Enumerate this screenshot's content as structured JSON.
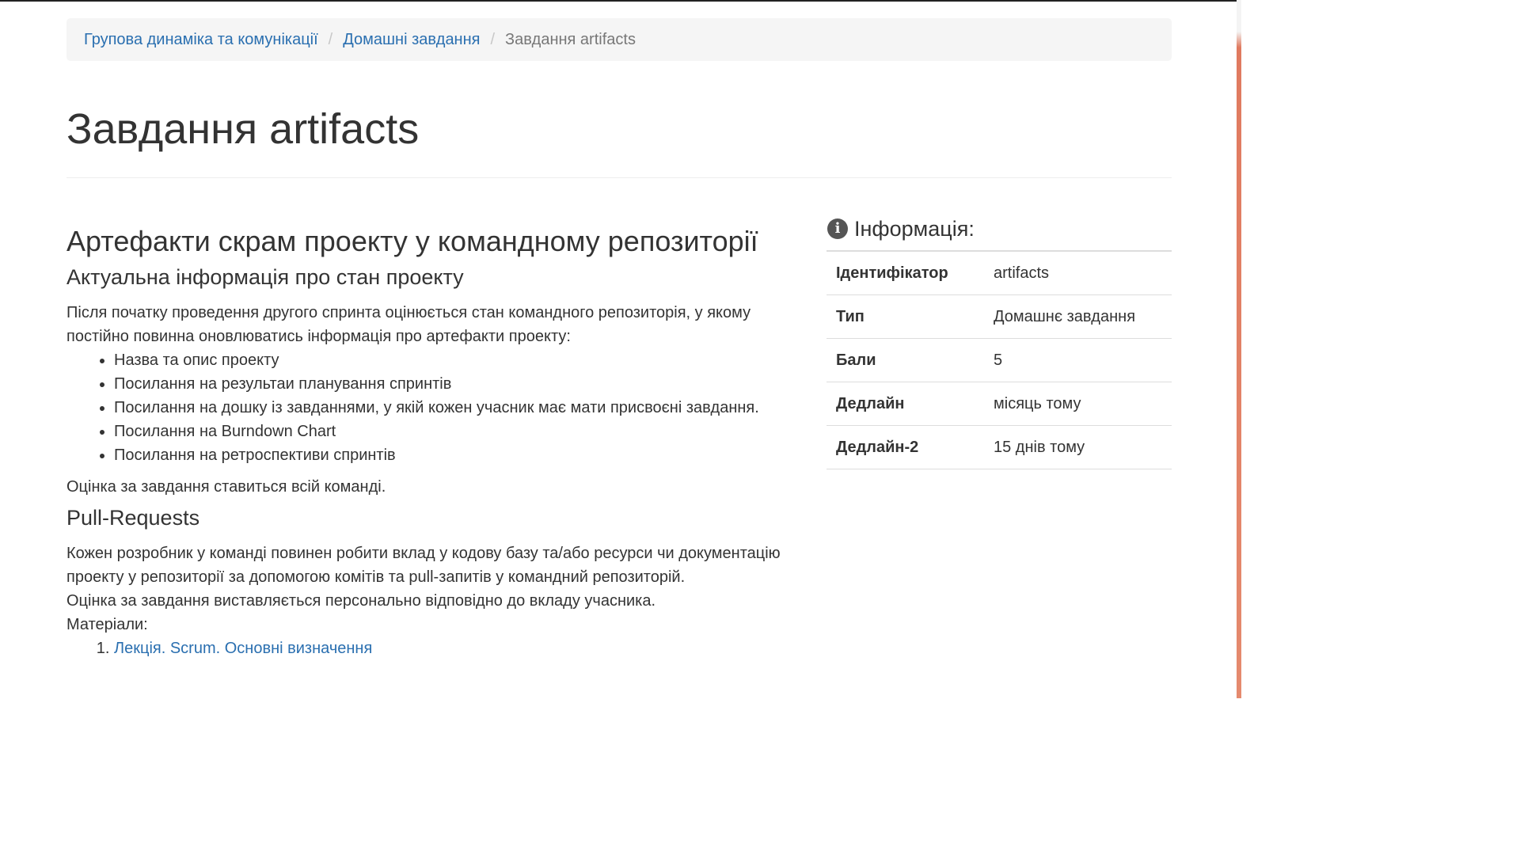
{
  "breadcrumb": {
    "items": [
      "Групова динаміка та комунікації",
      "Домашні завдання"
    ],
    "active": "Завдання artifacts",
    "separator": "/"
  },
  "page_title": "Завдання artifacts",
  "content": {
    "heading": "Артефакти скрам проекту у командному репозиторії",
    "section1": {
      "title": "Актуальна інформація про стан проекту",
      "intro": "Після початку проведення другого спринта оцінюється стан командного репозиторія, у якому постійно повинна оновлюватись інформація про артефакти проекту:",
      "items": [
        "Назва та опис проекту",
        "Посилання на результаи планування спринтів",
        "Посилання на дошку із завданнями, у якій кожен учасник має мати присвоєні завдання.",
        "Посилання на Burndown Chart",
        "Посилання на ретроспективи спринтів"
      ],
      "note": "Оцінка за завдання ставиться всій команді."
    },
    "section2": {
      "title": "Pull-Requests",
      "text": "Кожен розробник у команді повинен робити вклад у кодову базу та/або ресурси чи документацію проекту у репозиторії за допомогою комітів та pull-запитів у командний репозиторій.",
      "note": "Оцінка за завдання виставляється персонально відповідно до вкладу учасника.",
      "materials_label": "Матеріали:",
      "materials": [
        "Лекція. Scrum. Основні визначення"
      ]
    }
  },
  "sidebar": {
    "title": "Інформація:",
    "icon": "info-circle-icon",
    "rows": [
      {
        "key": "Ідентифікатор",
        "value": "artifacts"
      },
      {
        "key": "Тип",
        "value": "Домашнє завдання"
      },
      {
        "key": "Бали",
        "value": "5"
      },
      {
        "key": "Дедлайн",
        "value": "місяць тому"
      },
      {
        "key": "Дедлайн-2",
        "value": "15 днів тому"
      }
    ]
  },
  "colors": {
    "link": "#2a6fb0",
    "breadcrumb_bg": "#f5f5f5",
    "text": "#333333"
  }
}
